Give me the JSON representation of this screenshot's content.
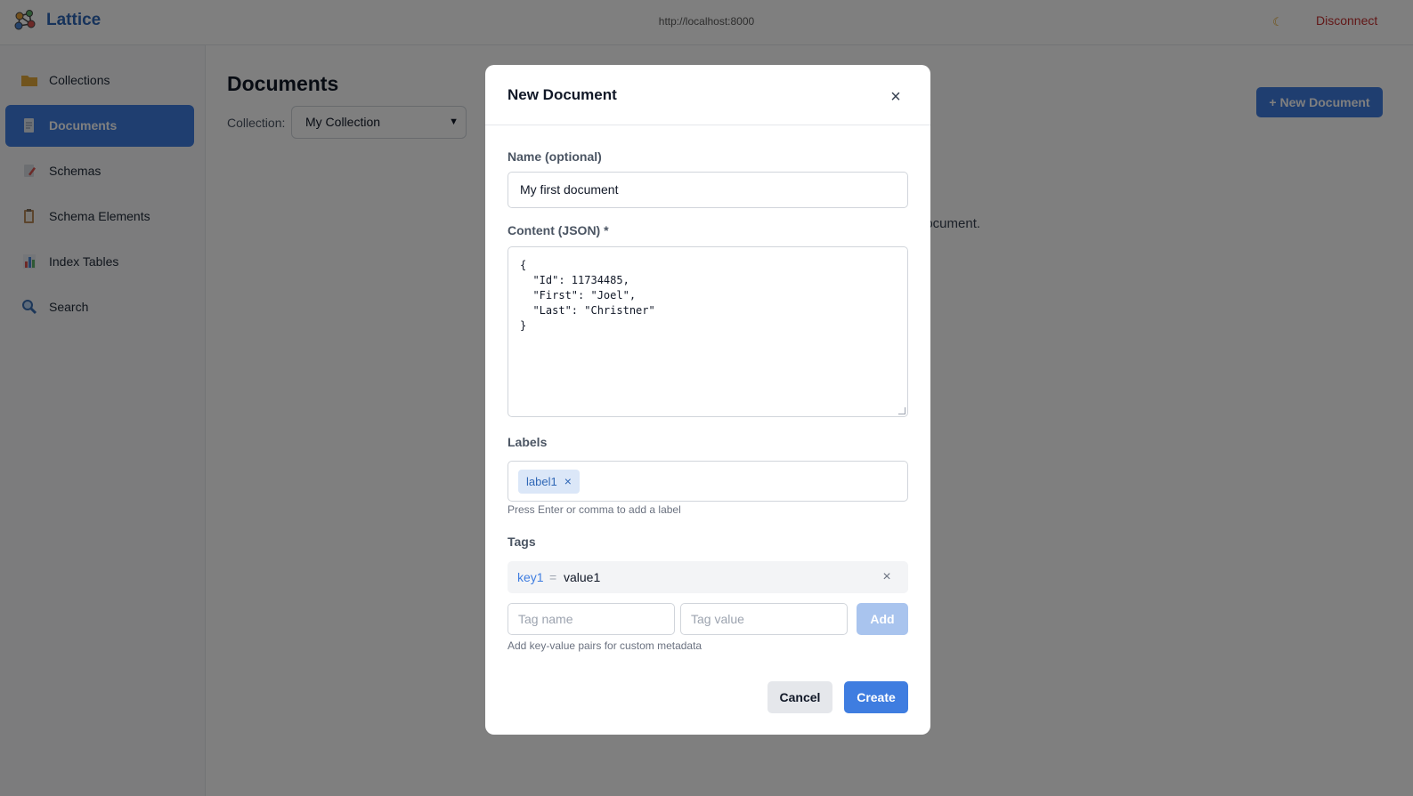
{
  "header": {
    "app_title": "Lattice",
    "server_url": "http://localhost:8000",
    "theme_icon": "moon-icon",
    "disconnect_label": "Disconnect"
  },
  "sidebar": {
    "items": [
      {
        "label": "Collections",
        "icon": "folder-icon",
        "active": false
      },
      {
        "label": "Documents",
        "icon": "document-icon",
        "active": true
      },
      {
        "label": "Schemas",
        "icon": "schema-icon",
        "active": false
      },
      {
        "label": "Schema Elements",
        "icon": "clipboard-icon",
        "active": false
      },
      {
        "label": "Index Tables",
        "icon": "bar-chart-icon",
        "active": false
      },
      {
        "label": "Search",
        "icon": "magnifier-icon",
        "active": false
      }
    ]
  },
  "main": {
    "title": "Documents",
    "collection_label": "Collection:",
    "collection_value": "My Collection",
    "new_document_label": "+ New Document",
    "empty_text_fragment": "document."
  },
  "modal": {
    "title": "New Document",
    "name_label": "Name (optional)",
    "name_value": "My first document",
    "content_label": "Content (JSON) *",
    "content_value": "{\n  \"Id\": 11734485,\n  \"First\": \"Joel\",\n  \"Last\": \"Christner\"\n}",
    "labels_label": "Labels",
    "labels": [
      "label1"
    ],
    "labels_helper": "Press Enter or comma to add a label",
    "tags_label": "Tags",
    "tags": [
      {
        "key": "key1",
        "value": "value1"
      }
    ],
    "tag_name_placeholder": "Tag name",
    "tag_value_placeholder": "Tag value",
    "add_label": "Add",
    "tags_helper": "Add key-value pairs for custom metadata",
    "cancel_label": "Cancel",
    "create_label": "Create"
  },
  "colors": {
    "accent": "#3f7de0",
    "brand": "#2f67b6",
    "danger": "#c53030"
  }
}
